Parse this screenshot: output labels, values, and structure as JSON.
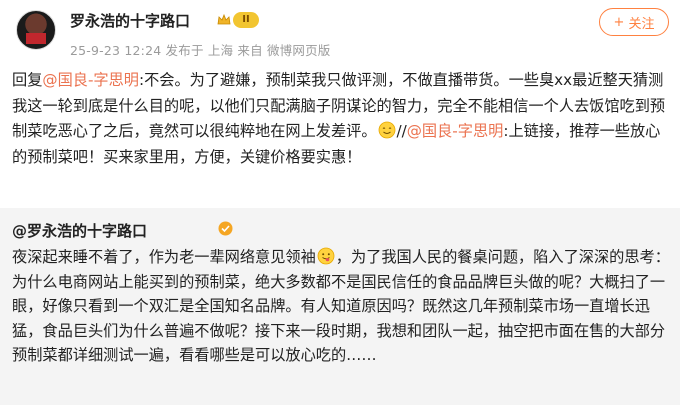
{
  "post": {
    "username": "罗永浩的十字路口",
    "vip_level": "II",
    "meta": "25-9-23 12:24  发布于 上海  来自 微博网页版",
    "follow_label": "关注",
    "follow_icon": "+",
    "text_prefix": "回复",
    "mention_1": "@国良-字思明",
    "text_1": ":不会。为了避嫌，预制菜我只做评测，不做直播带货。一些臭xx最近整天猜测我这一轮到底是什么目的呢，以他们只配满脑子阴谋论的智力，完全不能相信一个人去饭馆吃到预制菜吃恶心了之后，竟然可以很纯粹地在网上发差评。",
    "separator": "//",
    "mention_2": "@国良-字思明",
    "text_2": ":上链接，推荐一些放心的预制菜吧！买来家里用，方便，关键价格要实惠！",
    "emoji_1": "smile-emoji"
  },
  "repost": {
    "author": "@罗永浩的十字路口",
    "text_1": "夜深起来睡不着了，作为老一辈网络意见领袖",
    "emoji": "tongue-emoji",
    "text_2": "，为了我国人民的餐桌问题，陷入了深深的思考：为什么电商网站上能买到的预制菜，绝大多数都不是国民信任的食品品牌巨头做的呢？大概扫了一眼，好像只看到一个双汇是全国知名品牌。有人知道原因吗？既然这几年预制菜市场一直增长迅猛，食品巨头们为什么普遍不做呢？接下来一段时期，我想和团队一起，抽空把市面在售的大部分预制菜都详细测试一遍，看看哪些是可以放心吃的……"
  },
  "colors": {
    "accent": "#ff8140",
    "mention": "#eb7350",
    "repost_bg": "#f4f4f4",
    "meta": "#9b9b9b"
  }
}
